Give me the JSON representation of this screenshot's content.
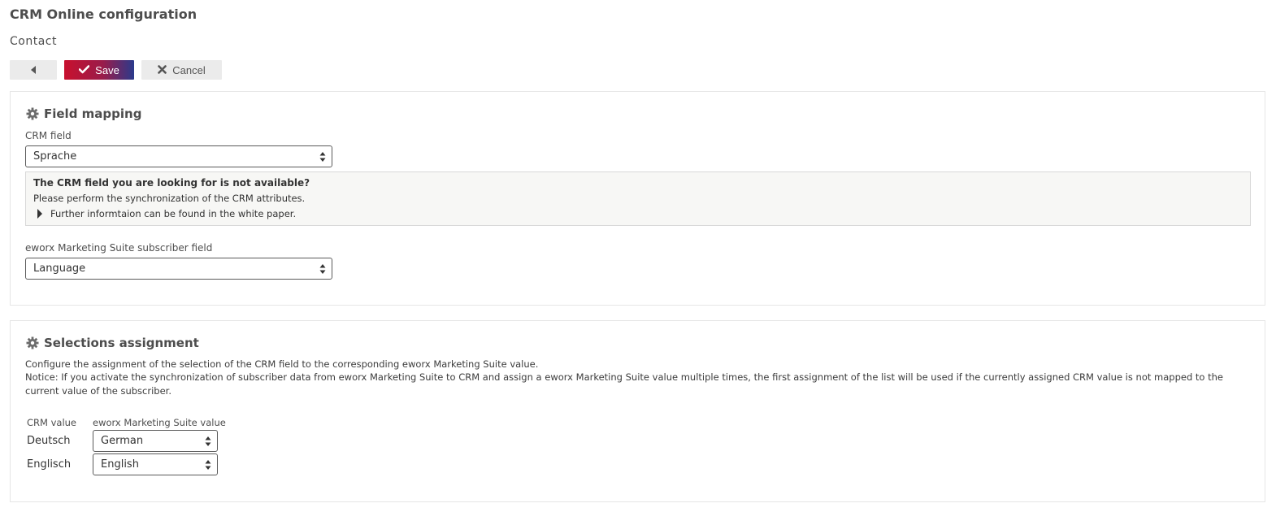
{
  "page": {
    "title": "CRM Online configuration",
    "subtitle": "Contact"
  },
  "toolbar": {
    "back_icon": "caret-left-icon",
    "save_label": "Save",
    "save_icon": "check-icon",
    "cancel_label": "Cancel",
    "cancel_icon": "close-icon"
  },
  "field_mapping": {
    "heading": "Field mapping",
    "heading_icon": "gear-icon",
    "crm_field_label": "CRM field",
    "crm_field_value": "Sprache",
    "info": {
      "title": "The CRM field you are looking for is not available?",
      "text": "Please perform the synchronization of the CRM attributes.",
      "link": "Further informtaion can be found in the white paper."
    },
    "subscriber_field_label": "eworx Marketing Suite subscriber field",
    "subscriber_field_value": "Language"
  },
  "selections": {
    "heading": "Selections assignment",
    "heading_icon": "gear-icon",
    "description_1": "Configure the assignment of the selection of the CRM field to the corresponding eworx Marketing Suite value.",
    "description_2": "Notice: If you activate the synchronization of subscriber data from eworx Marketing Suite to CRM and assign a eworx Marketing Suite value multiple times, the first assignment of the list will be used if the currently assigned CRM value is not mapped to the current value of the subscriber.",
    "columns": [
      "CRM value",
      "eworx Marketing Suite value"
    ],
    "rows": [
      {
        "crm": "Deutsch",
        "ems": "German"
      },
      {
        "crm": "Englisch",
        "ems": "English"
      }
    ]
  },
  "colors": {
    "save_gradient_start": "#c8102e",
    "save_gradient_end": "#2b3a8c",
    "panel_border": "#e6e6e6",
    "info_background": "#f7f7f5"
  }
}
